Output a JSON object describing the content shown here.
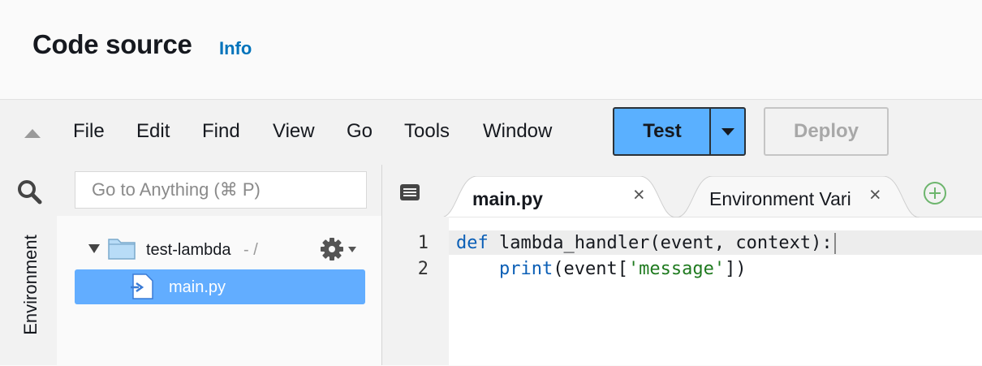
{
  "header": {
    "title": "Code source",
    "info_link": "Info"
  },
  "menubar": {
    "items": [
      "File",
      "Edit",
      "Find",
      "View",
      "Go",
      "Tools",
      "Window"
    ],
    "test_label": "Test",
    "deploy_label": "Deploy"
  },
  "sidebar": {
    "search_placeholder": "Go to Anything (⌘ P)",
    "side_tab_label": "Environment",
    "folder": {
      "name": "test-lambda",
      "path": "- /"
    },
    "files": [
      {
        "name": "main.py",
        "selected": true
      }
    ]
  },
  "editor": {
    "tabs": [
      {
        "label": "main.py",
        "active": true,
        "close": "×"
      },
      {
        "label": "Environment Vari",
        "active": false,
        "close": "×"
      }
    ],
    "lines": [
      {
        "num": "1",
        "tokens": [
          [
            "kw",
            "def"
          ],
          [
            "",
            " "
          ],
          [
            "fn",
            "lambda_handler"
          ],
          [
            "",
            "(event, context):"
          ]
        ]
      },
      {
        "num": "2",
        "tokens": [
          [
            "",
            "    "
          ],
          [
            "builtin",
            "print"
          ],
          [
            "",
            "(event["
          ],
          [
            "str",
            "'message'"
          ],
          [
            "",
            "])"
          ]
        ]
      }
    ]
  },
  "colors": {
    "accent": "#0073bb",
    "test_button": "#5ab0ff",
    "selected_file": "#62adff"
  }
}
